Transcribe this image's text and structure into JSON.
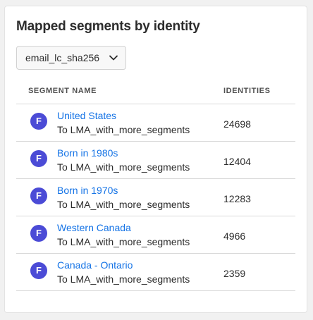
{
  "card": {
    "title": "Mapped segments by identity"
  },
  "identity_select": {
    "selected": "email_lc_sha256"
  },
  "table": {
    "columns": {
      "segment": "SEGMENT NAME",
      "identities": "IDENTITIES"
    },
    "rows": [
      {
        "avatar": "F",
        "name": "United States",
        "destination": "To LMA_with_more_segments",
        "identities": "24698"
      },
      {
        "avatar": "F",
        "name": "Born in 1980s",
        "destination": "To LMA_with_more_segments",
        "identities": "12404"
      },
      {
        "avatar": "F",
        "name": "Born in 1970s",
        "destination": "To LMA_with_more_segments",
        "identities": "12283"
      },
      {
        "avatar": "F",
        "name": "Western Canada",
        "destination": "To LMA_with_more_segments",
        "identities": "4966"
      },
      {
        "avatar": "F",
        "name": "Canada - Ontario",
        "destination": "To LMA_with_more_segments",
        "identities": "2359"
      }
    ]
  },
  "colors": {
    "accent_link": "#1473e6",
    "avatar_bg": "#4b4bd6"
  },
  "icons": {
    "dropdown": "chevron-down-icon"
  }
}
